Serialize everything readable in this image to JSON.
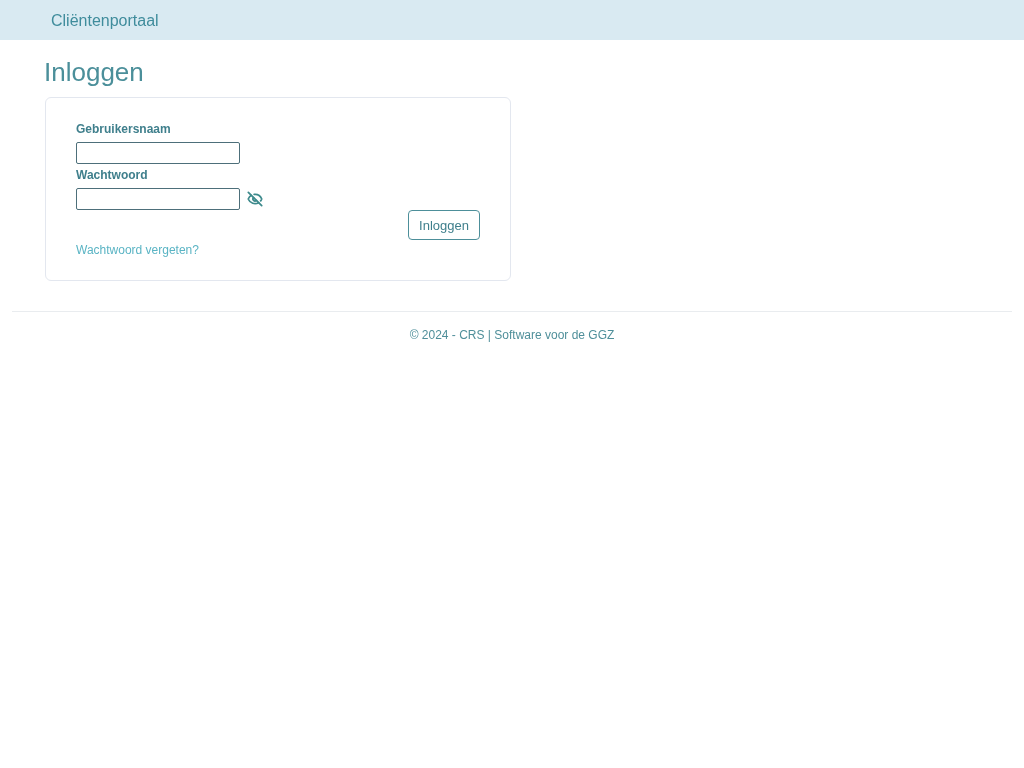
{
  "header": {
    "brand": "Cliëntenportaal"
  },
  "page_title": "Inloggen",
  "login_form": {
    "username": {
      "label": "Gebruikersnaam"
    },
    "password": {
      "label": "Wachtwoord",
      "revealed": false
    },
    "submit_button": "Inloggen",
    "forgot_link": "Wachtwoord vergeten?"
  },
  "footer": {
    "text": "© 2024 - CRS | Software voor de GGZ"
  }
}
